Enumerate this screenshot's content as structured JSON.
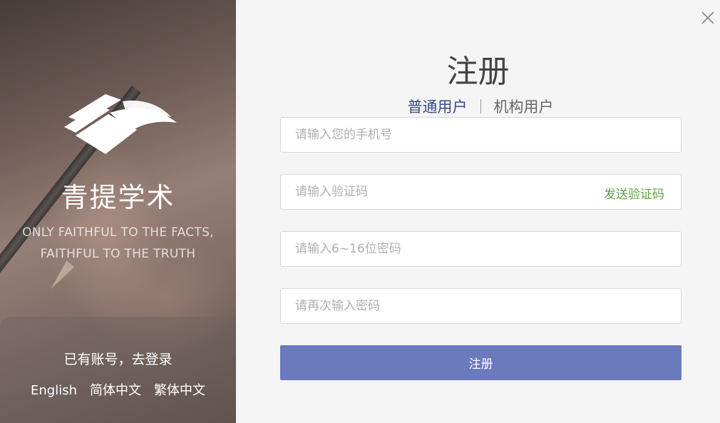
{
  "brand": {
    "name": "青提学术",
    "slogan_line1": "ONLY FAITHFUL TO THE FACTS,",
    "slogan_line2": "FAITHFUL TO THE TRUTH"
  },
  "login_prompt": "已有账号，去登录",
  "languages": [
    "English",
    "简体中文",
    "繁体中文"
  ],
  "form": {
    "title": "注册",
    "tabs": [
      {
        "label": "普通用户",
        "active": true
      },
      {
        "label": "机构用户",
        "active": false
      }
    ],
    "phone_placeholder": "请输入您的手机号",
    "code_placeholder": "请输入验证码",
    "send_code_label": "发送验证码",
    "password_placeholder": "请输入6~16位密码",
    "confirm_placeholder": "请再次输入密码",
    "submit_label": "注册"
  },
  "icons": {
    "close": "close-icon",
    "logo": "book-logo-icon"
  },
  "colors": {
    "accent": "#6b7abd",
    "active_tab": "#394a8c",
    "send_code": "#5fa543"
  }
}
